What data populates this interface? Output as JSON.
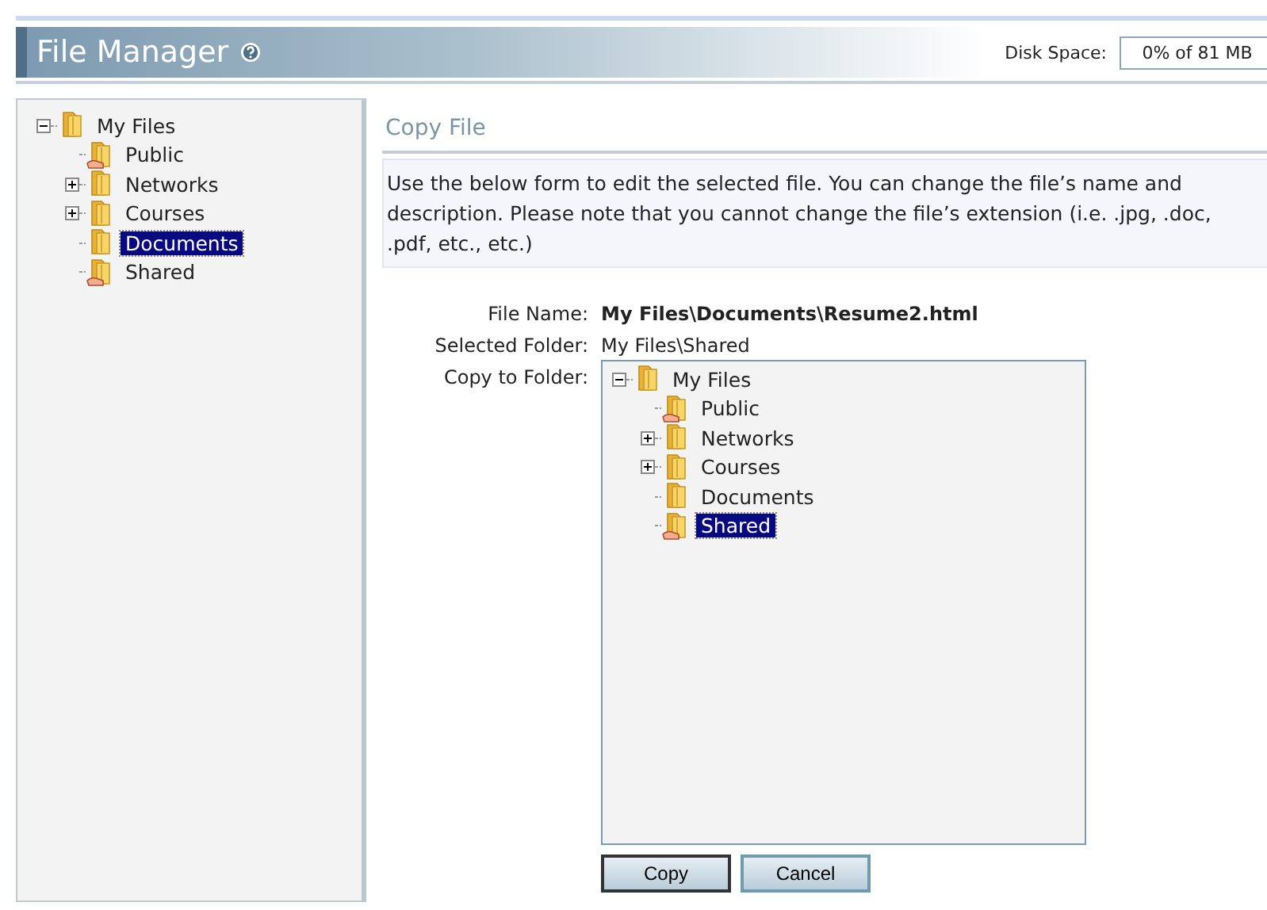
{
  "header": {
    "title": "File Manager",
    "disk_space_label": "Disk Space:",
    "disk_space_value": "0% of 81 MB"
  },
  "sidebar": {
    "tree": [
      {
        "label": "My Files",
        "kind": "open_branch",
        "shared": false,
        "selected": false,
        "children": [
          {
            "label": "Public",
            "kind": "leaf",
            "shared": true,
            "selected": false
          },
          {
            "label": "Networks",
            "kind": "closed_branch",
            "shared": false,
            "selected": false
          },
          {
            "label": "Courses",
            "kind": "closed_branch",
            "shared": false,
            "selected": false
          },
          {
            "label": "Documents",
            "kind": "leaf",
            "shared": false,
            "selected": true
          },
          {
            "label": "Shared",
            "kind": "leaf",
            "shared": true,
            "selected": false
          }
        ]
      }
    ]
  },
  "content": {
    "title": "Copy File",
    "description": "Use the below form to edit the selected file. You can change the file’s name and description. Please note that you cannot change the file’s extension (i.e. .jpg, .doc, .pdf, etc., etc.)",
    "fields": [
      {
        "label": "File Name:",
        "value": "My Files\\Documents\\Resume2.html",
        "kind": "bold"
      },
      {
        "label": "Selected Folder:",
        "value": "My Files\\Shared",
        "kind": "plain"
      },
      {
        "label": "Copy to Folder:",
        "kind": "tree",
        "tree": [
          {
            "label": "My Files",
            "kind": "open_branch",
            "shared": false,
            "selected": false,
            "children": [
              {
                "label": "Public",
                "kind": "leaf",
                "shared": true,
                "selected": false
              },
              {
                "label": "Networks",
                "kind": "closed_branch",
                "shared": false,
                "selected": false
              },
              {
                "label": "Courses",
                "kind": "closed_branch",
                "shared": false,
                "selected": false
              },
              {
                "label": "Documents",
                "kind": "leaf",
                "shared": false,
                "selected": false
              },
              {
                "label": "Shared",
                "kind": "leaf",
                "shared": true,
                "selected": true
              }
            ]
          }
        ]
      }
    ],
    "buttons": [
      {
        "label": "Copy",
        "default": true
      },
      {
        "label": "Cancel",
        "default": false
      }
    ]
  }
}
